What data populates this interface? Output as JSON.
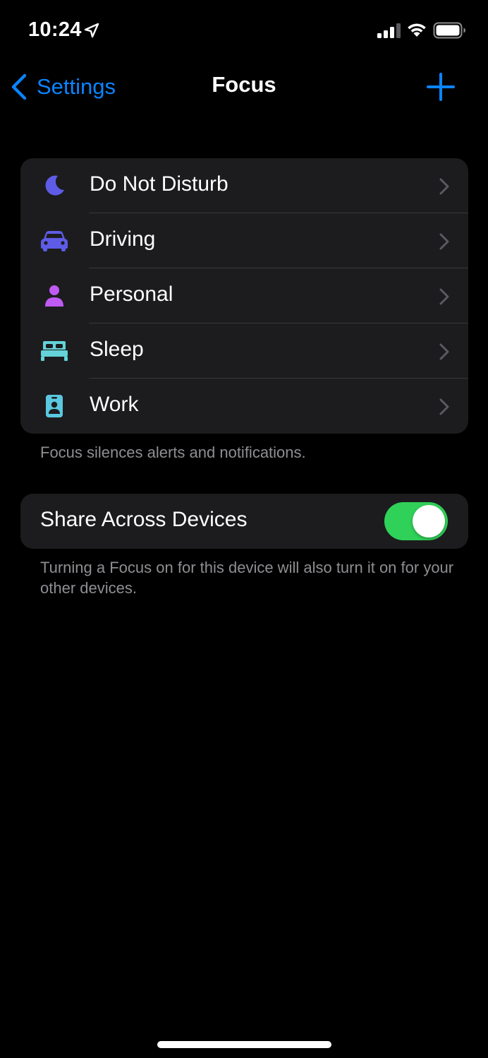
{
  "status_bar": {
    "time": "10:24",
    "icons": [
      "location-arrow-icon",
      "cellular-signal-icon",
      "wifi-icon",
      "battery-icon"
    ]
  },
  "nav": {
    "back_label": "Settings",
    "title": "Focus",
    "add_icon": "plus-icon",
    "accent_color": "#0a84ff"
  },
  "focus_modes": [
    {
      "label": "Do Not Disturb",
      "icon": "moon-icon",
      "color": "#5e5ce6"
    },
    {
      "label": "Driving",
      "icon": "car-icon",
      "color": "#5e5ce6"
    },
    {
      "label": "Personal",
      "icon": "person-icon",
      "color": "#bf5af2"
    },
    {
      "label": "Sleep",
      "icon": "bed-icon",
      "color": "#64d2d8"
    },
    {
      "label": "Work",
      "icon": "id-badge-icon",
      "color": "#5ac8e0"
    }
  ],
  "focus_footer": "Focus silences alerts and notifications.",
  "share": {
    "label": "Share Across Devices",
    "toggle_on": true,
    "toggle_color": "#30d158",
    "footer": "Turning a Focus on for this device will also turn it on for your other devices."
  }
}
